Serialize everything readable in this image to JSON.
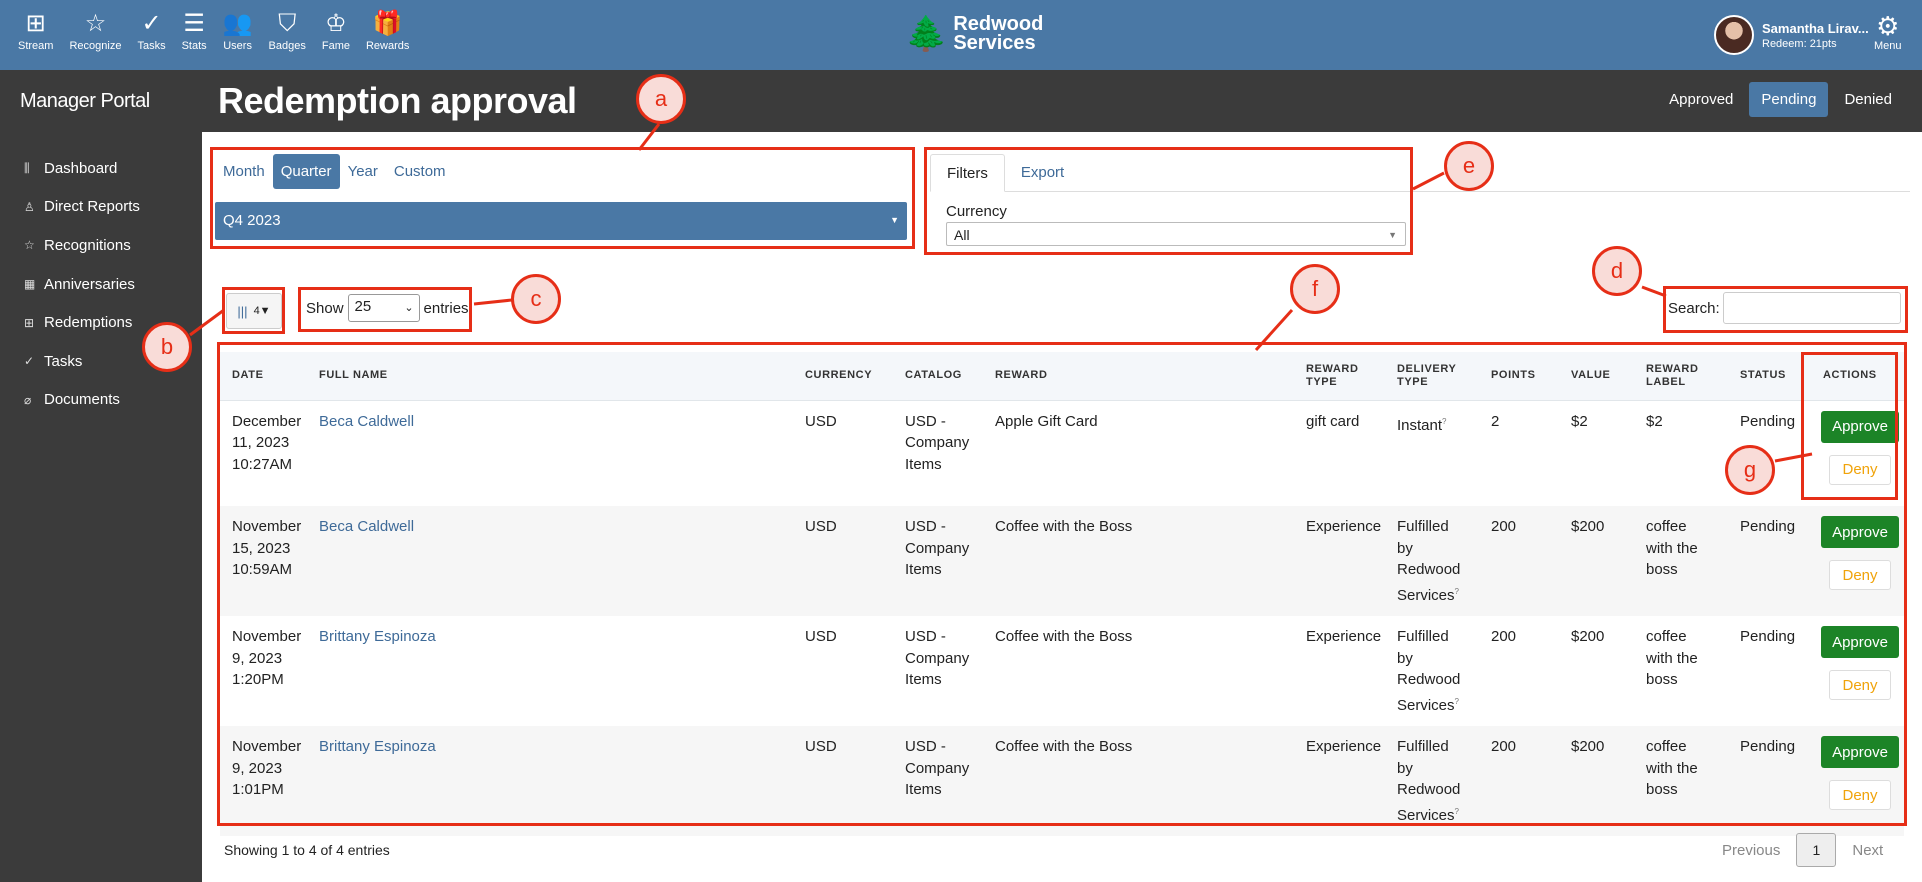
{
  "topnav": {
    "items": [
      {
        "label": "Stream",
        "icon": "grid-icon",
        "glyph": "⊞"
      },
      {
        "label": "Recognize",
        "icon": "star-icon",
        "glyph": "☆"
      },
      {
        "label": "Tasks",
        "icon": "check-circle-icon",
        "glyph": "✓"
      },
      {
        "label": "Stats",
        "icon": "list-icon",
        "glyph": "☰"
      },
      {
        "label": "Users",
        "icon": "users-icon",
        "glyph": "👥"
      },
      {
        "label": "Badges",
        "icon": "shield-icon",
        "glyph": "⛉"
      },
      {
        "label": "Fame",
        "icon": "award-icon",
        "glyph": "♔"
      },
      {
        "label": "Rewards",
        "icon": "gift-icon",
        "glyph": "🎁"
      }
    ],
    "brand_line1": "Redwood",
    "brand_line2": "Services",
    "user_name": "Samantha Lirav...",
    "user_points": "Redeem: 21pts",
    "menu_label": "Menu"
  },
  "sidebar": {
    "title": "Manager Portal",
    "items": [
      {
        "label": "Dashboard",
        "icon": "bar-chart-icon",
        "glyph": "⫼"
      },
      {
        "label": "Direct Reports",
        "icon": "user-icon",
        "glyph": "♙"
      },
      {
        "label": "Recognitions",
        "icon": "star-icon",
        "glyph": "☆"
      },
      {
        "label": "Anniversaries",
        "icon": "calendar-icon",
        "glyph": "▦"
      },
      {
        "label": "Redemptions",
        "icon": "gift-icon",
        "glyph": "⊞"
      },
      {
        "label": "Tasks",
        "icon": "check-circle-icon",
        "glyph": "✓"
      },
      {
        "label": "Documents",
        "icon": "paperclip-icon",
        "glyph": "⌀"
      }
    ]
  },
  "header": {
    "title": "Redemption approval",
    "status_tabs": [
      "Approved",
      "Pending",
      "Denied"
    ],
    "active_status": "Pending"
  },
  "period": {
    "tabs": [
      "Month",
      "Quarter",
      "Year",
      "Custom"
    ],
    "active": "Quarter",
    "selected": "Q4 2023"
  },
  "filters": {
    "tabs": [
      "Filters",
      "Export"
    ],
    "active": "Filters",
    "currency_label": "Currency",
    "currency_value": "All"
  },
  "table_controls": {
    "column_count": "4▼",
    "show_label": "Show",
    "entries_value": "25",
    "entries_label": "entries",
    "search_label": "Search:",
    "search_value": ""
  },
  "table": {
    "columns": [
      "DATE",
      "FULL NAME",
      "CURRENCY",
      "CATALOG",
      "REWARD",
      "REWARD TYPE",
      "DELIVERY TYPE",
      "POINTS",
      "VALUE",
      "REWARD LABEL",
      "STATUS",
      "ACTIONS"
    ],
    "approve_label": "Approve",
    "deny_label": "Deny",
    "rows": [
      {
        "date": "December 11, 2023 10:27AM",
        "name": "Beca Caldwell",
        "currency": "USD",
        "catalog": "USD - Company Items",
        "reward": "Apple Gift Card",
        "reward_type": "gift card",
        "delivery_type": "Instant",
        "points": "2",
        "value": "$2",
        "reward_label": "$2",
        "status": "Pending"
      },
      {
        "date": "November 15, 2023 10:59AM",
        "name": "Beca Caldwell",
        "currency": "USD",
        "catalog": "USD - Company Items",
        "reward": "Coffee with the Boss",
        "reward_type": "Experience",
        "delivery_type": "Fulfilled by Redwood Services",
        "points": "200",
        "value": "$200",
        "reward_label": "coffee with the boss",
        "status": "Pending"
      },
      {
        "date": "November 9, 2023 1:20PM",
        "name": "Brittany Espinoza",
        "currency": "USD",
        "catalog": "USD - Company Items",
        "reward": "Coffee with the Boss",
        "reward_type": "Experience",
        "delivery_type": "Fulfilled by Redwood Services",
        "points": "200",
        "value": "$200",
        "reward_label": "coffee with the boss",
        "status": "Pending"
      },
      {
        "date": "November 9, 2023 1:01PM",
        "name": "Brittany Espinoza",
        "currency": "USD",
        "catalog": "USD - Company Items",
        "reward": "Coffee with the Boss",
        "reward_type": "Experience",
        "delivery_type": "Fulfilled by Redwood Services",
        "points": "200",
        "value": "$200",
        "reward_label": "coffee with the boss",
        "status": "Pending"
      }
    ]
  },
  "footer": {
    "info": "Showing 1 to 4 of 4 entries",
    "previous": "Previous",
    "page": "1",
    "next": "Next"
  },
  "annotations": [
    "a",
    "b",
    "c",
    "d",
    "e",
    "f",
    "g"
  ],
  "colors": {
    "accent": "#4a78a5",
    "approve": "#1c8427",
    "deny": "#f0a30a",
    "annotation": "#e62e17"
  }
}
